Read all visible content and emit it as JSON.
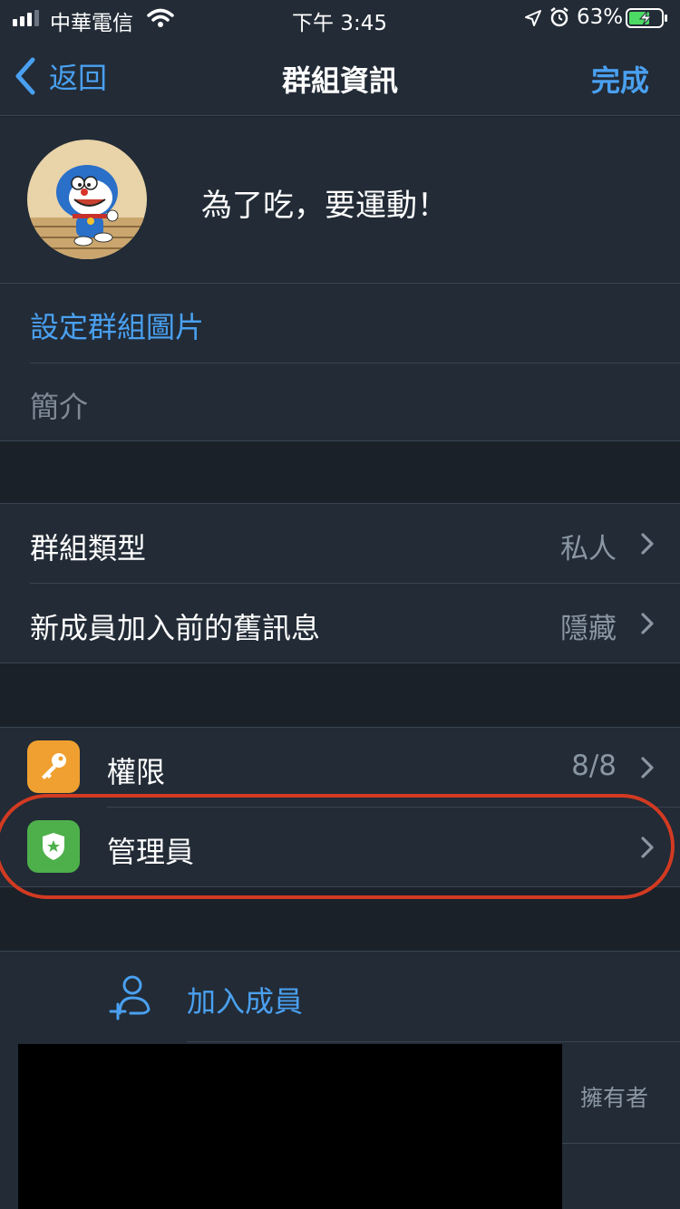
{
  "status_bar": {
    "carrier": "中華電信",
    "time": "下午 3:45",
    "battery": "63%"
  },
  "nav": {
    "back_label": "返回",
    "title": "群組資訊",
    "done_label": "完成"
  },
  "group": {
    "name": "為了吃，要運動！",
    "set_photo_label": "設定群組圖片",
    "description_placeholder": "簡介"
  },
  "settings": {
    "group_type_label": "群組類型",
    "group_type_value": "私人",
    "history_label": "新成員加入前的舊訊息",
    "history_value": "隱藏"
  },
  "admin_section": {
    "permissions_label": "權限",
    "permissions_value": "8/8",
    "admins_label": "管理員"
  },
  "members": {
    "add_member_label": "加入成員",
    "owner_label": "擁有者"
  },
  "colors": {
    "accent": "#4aa0f0",
    "background": "#1a2129",
    "cell": "#222b36",
    "permissions_icon": "#f0a030",
    "admins_icon": "#4db04a",
    "highlight": "#d23a22"
  },
  "icons": [
    "back-chevron-icon",
    "signal-icon",
    "wifi-icon",
    "location-icon",
    "alarm-icon",
    "battery-icon",
    "key-icon",
    "shield-star-icon",
    "add-person-icon",
    "chevron-right-icon"
  ]
}
